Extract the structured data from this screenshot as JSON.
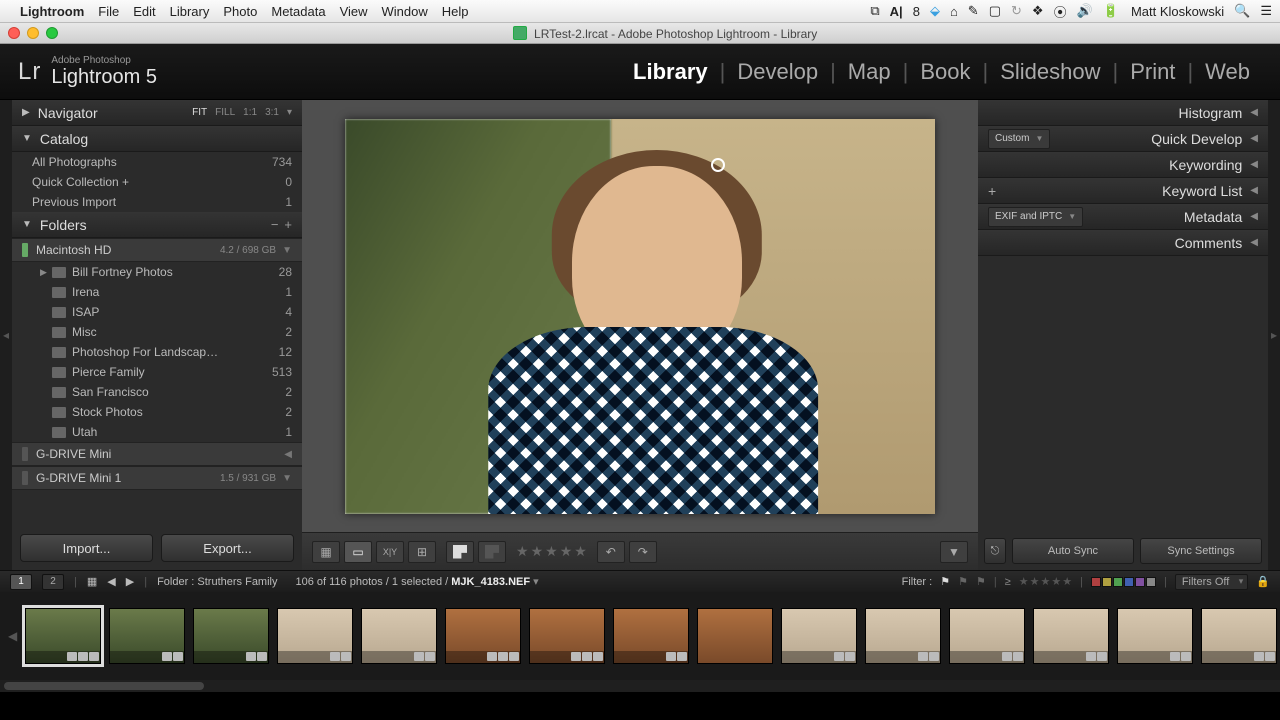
{
  "mac_menu": {
    "app": "Lightroom",
    "items": [
      "File",
      "Edit",
      "Library",
      "Photo",
      "Metadata",
      "View",
      "Window",
      "Help"
    ],
    "user": "Matt Kloskowski"
  },
  "window": {
    "title": "LRTest-2.lrcat - Adobe Photoshop Lightroom - Library"
  },
  "brand": {
    "small": "Adobe Photoshop",
    "big": "Lightroom 5",
    "lr": "Lr"
  },
  "modules": [
    "Library",
    "Develop",
    "Map",
    "Book",
    "Slideshow",
    "Print",
    "Web"
  ],
  "active_module": "Library",
  "navigator": {
    "label": "Navigator",
    "opts": [
      "FIT",
      "FILL",
      "1:1",
      "3:1"
    ],
    "active_opt": "FIT"
  },
  "catalog": {
    "label": "Catalog",
    "rows": [
      {
        "label": "All Photographs",
        "count": "734"
      },
      {
        "label": "Quick Collection  +",
        "count": "0"
      },
      {
        "label": "Previous Import",
        "count": "1"
      }
    ]
  },
  "folders": {
    "label": "Folders",
    "drives": [
      {
        "name": "Macintosh HD",
        "size": "4.2 / 698 GB",
        "expanded": true,
        "bar": "green",
        "children": [
          {
            "name": "Bill Fortney Photos",
            "count": "28",
            "exp": true
          },
          {
            "name": "Irena",
            "count": "1"
          },
          {
            "name": "ISAP",
            "count": "4"
          },
          {
            "name": "Misc",
            "count": "2"
          },
          {
            "name": "Photoshop For Landscap…",
            "count": "12"
          },
          {
            "name": "Pierce Family",
            "count": "513"
          },
          {
            "name": "San Francisco",
            "count": "2"
          },
          {
            "name": "Stock Photos",
            "count": "2"
          },
          {
            "name": "Utah",
            "count": "1"
          }
        ]
      },
      {
        "name": "G-DRIVE Mini",
        "size": "",
        "bar": "dim"
      },
      {
        "name": "G-DRIVE Mini 1",
        "size": "1.5 / 931 GB",
        "bar": "dim"
      }
    ]
  },
  "import_btn": "Import...",
  "export_btn": "Export...",
  "right_panels": {
    "histogram": "Histogram",
    "quick_develop": "Quick Develop",
    "qd_preset": "Custom",
    "keywording": "Keywording",
    "keyword_list": "Keyword List",
    "metadata": "Metadata",
    "meta_preset": "EXIF and IPTC",
    "comments": "Comments"
  },
  "sync": {
    "auto": "Auto Sync",
    "settings": "Sync Settings"
  },
  "filmstrip_hdr": {
    "source": "Folder : Struthers Family",
    "counts": "106 of 116 photos / 1 selected /",
    "filename": "MJK_4183.NEF",
    "filter_label": "Filter :",
    "filters_off": "Filters Off",
    "btn1": "1",
    "btn2": "2"
  },
  "colors": {
    "label_red": "#b04040",
    "label_yellow": "#b0a040",
    "label_green": "#50a050",
    "label_blue": "#4060b0",
    "label_purple": "#8050a0",
    "label_none": "#888"
  }
}
